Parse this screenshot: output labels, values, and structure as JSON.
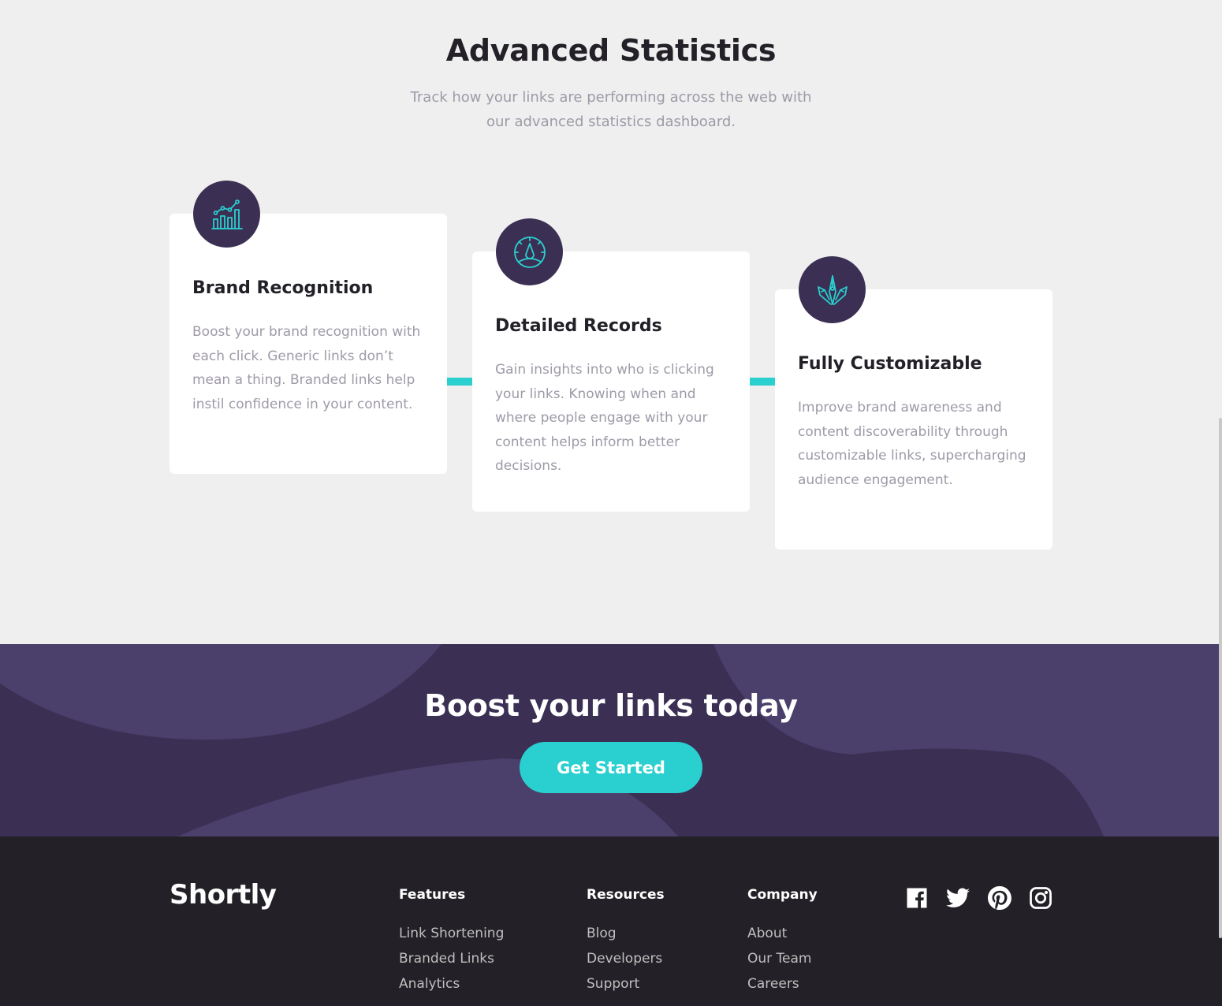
{
  "stats": {
    "title": "Advanced Statistics",
    "subtitle": "Track how your links are performing across the web with our advanced statistics dashboard.",
    "cards": [
      {
        "icon": "brand-recognition-icon",
        "title": "Brand Recognition",
        "text": "Boost your brand recognition with each click. Generic links don’t  mean a thing. Branded links help instil confidence in your content."
      },
      {
        "icon": "detailed-records-icon",
        "title": "Detailed Records",
        "text": "Gain insights into who is clicking your links. Knowing when and where  people engage with your content helps inform better decisions."
      },
      {
        "icon": "fully-customizable-icon",
        "title": "Fully Customizable",
        "text": "Improve brand awareness and content discoverability through customizable  links, supercharging audience engagement."
      }
    ]
  },
  "boost": {
    "title": "Boost your links today",
    "cta_label": "Get Started"
  },
  "footer": {
    "logo": "Shortly",
    "columns": [
      {
        "title": "Features",
        "links": [
          "Link Shortening",
          "Branded Links",
          "Analytics"
        ]
      },
      {
        "title": "Resources",
        "links": [
          "Blog",
          "Developers",
          "Support"
        ]
      },
      {
        "title": "Company",
        "links": [
          "About",
          "Our Team",
          "Careers"
        ]
      }
    ],
    "social": [
      "facebook-icon",
      "twitter-icon",
      "pinterest-icon",
      "instagram-icon"
    ]
  },
  "colors": {
    "accent": "#2acfcf",
    "dark_violet": "#3b3054",
    "very_dark": "#232127",
    "grayish_violet": "#9e9aa7",
    "background": "#efefef"
  }
}
